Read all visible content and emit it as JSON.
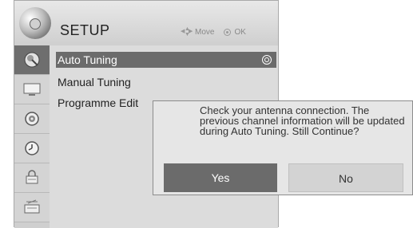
{
  "header": {
    "title": "SETUP",
    "move_hint": "Move",
    "ok_hint": "OK"
  },
  "sidebar": {
    "icons": [
      "setup-satellite-icon",
      "picture-icon",
      "audio-icon",
      "time-clock-icon",
      "lock-icon",
      "input-icon"
    ],
    "active_index": 0
  },
  "menu": {
    "items": [
      {
        "label": "Auto Tuning",
        "selected": true
      },
      {
        "label": "Manual Tuning",
        "selected": false
      },
      {
        "label": "Programme Edit",
        "selected": false
      }
    ]
  },
  "dialog": {
    "message": "Check your antenna connection. The previous channel information will be updated during Auto Tuning. Still Continue?",
    "buttons": {
      "yes": "Yes",
      "no": "No"
    },
    "focused": "yes"
  }
}
